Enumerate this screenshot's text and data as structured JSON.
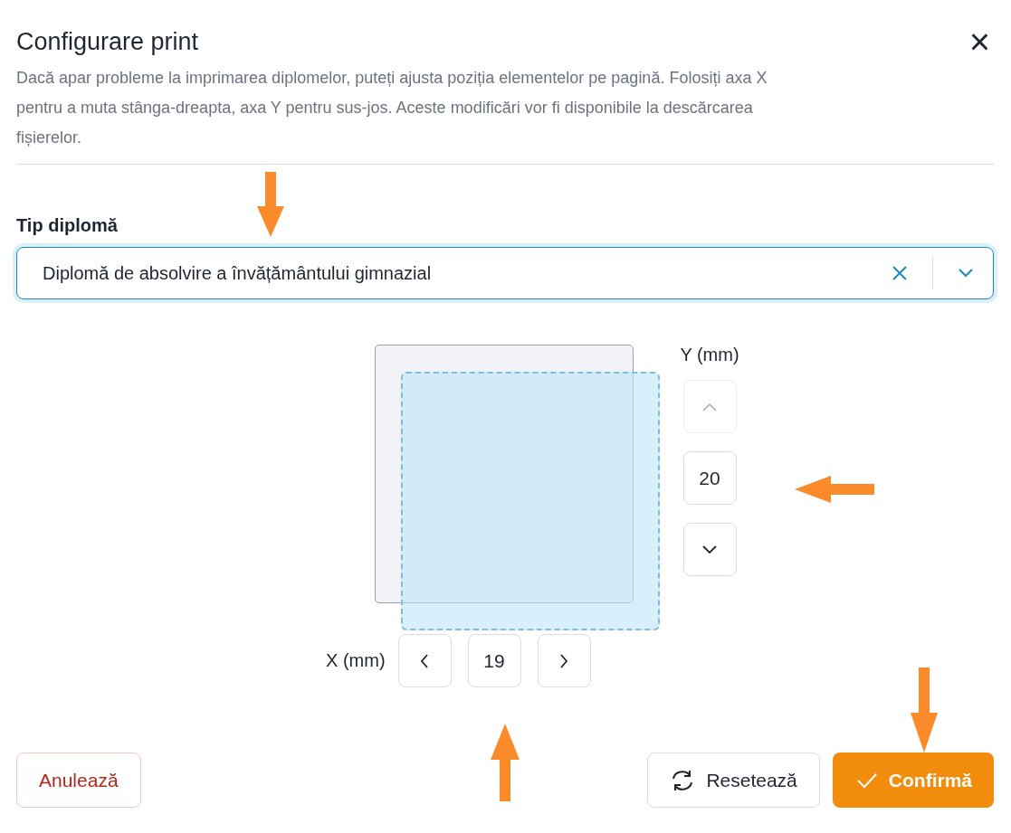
{
  "dialog": {
    "title": "Configurare print",
    "close": "×",
    "description": "Dacă apar probleme la imprimarea diplomelor, puteți ajusta poziția elementelor pe pagină. Folosiți axa X pentru a muta stânga-dreapta, axa Y pentru sus-jos. Aceste modificări vor fi disponibile la descărcarea fișierelor."
  },
  "diploma_type": {
    "label": "Tip diplomă",
    "value": "Diplomă de absolvire a învățământului gimnazial"
  },
  "y_axis": {
    "label": "Y (mm)",
    "value": "20",
    "up_disabled": true,
    "down_disabled": false
  },
  "x_axis": {
    "label": "X (mm)",
    "value": "19",
    "left_disabled": false,
    "right_disabled": false
  },
  "buttons": [
    {
      "kind": "cancel",
      "label": "Anulează"
    },
    {
      "kind": "reset",
      "label": "Resetează"
    },
    {
      "kind": "confirm",
      "label": "Confirmă"
    }
  ]
}
